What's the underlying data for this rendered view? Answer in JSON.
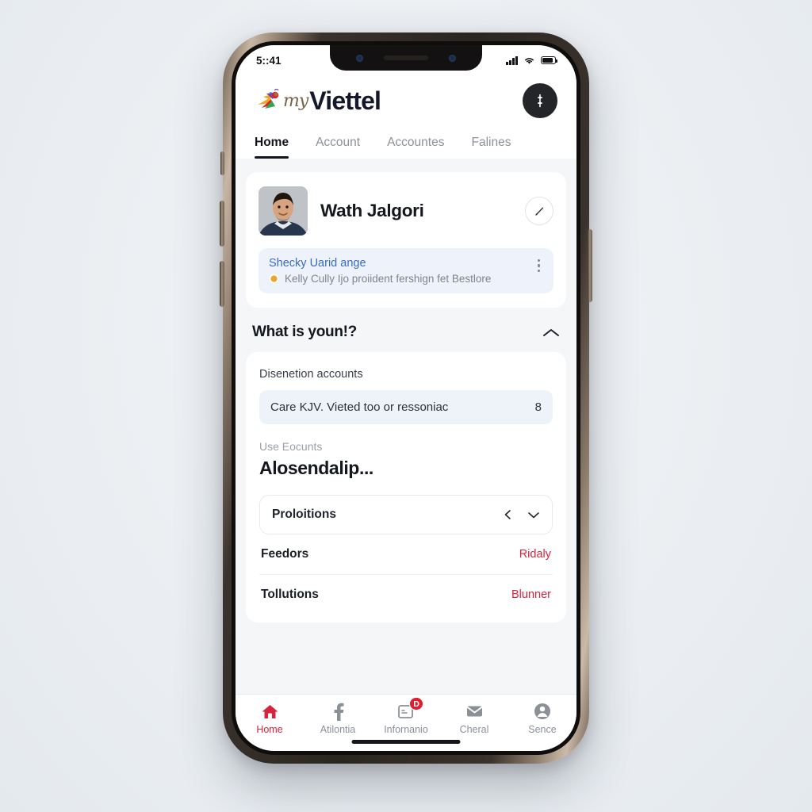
{
  "status_bar": {
    "time": "5::41",
    "signal_icon": "signal-bars-icon",
    "wifi_icon": "wifi-icon",
    "battery_icon": "battery-icon"
  },
  "header": {
    "brand_prefix": "my",
    "brand_name": "Viettel",
    "logo_icon": "viettel-butterfly-logo-icon",
    "assist_icon": "assistant-glyph-icon"
  },
  "tabs": [
    {
      "label": "Home",
      "active": true
    },
    {
      "label": "Account",
      "active": false
    },
    {
      "label": "Accountes",
      "active": false
    },
    {
      "label": "Falines",
      "active": false
    }
  ],
  "profile": {
    "name": "Wath Jalgori",
    "avatar_icon": "user-photo-avatar",
    "edit_icon": "pencil-edit-icon"
  },
  "notice": {
    "title": "Shecky Uarid ange",
    "subtitle": "Kelly Cully Ijo proiident fershign fet Bestlore",
    "dot_icon": "warning-dot-icon",
    "menu_icon": "more-vertical-icon"
  },
  "section": {
    "title": "What is youn!?",
    "collapse_icon": "chevron-up-icon"
  },
  "accounts_card": {
    "sub_label": "Disenetion accounts",
    "pill_text": "Care KJV. Vieted too or ressoniac",
    "pill_count": "8",
    "use_label": "Use Eocunts",
    "big_value": "Alosendalip...",
    "select_label": "Proloitions",
    "select_icon_left": "chevron-left-icon",
    "select_icon_right": "chevron-down-icon",
    "rows": [
      {
        "label": "Feedors",
        "value": "Ridaly"
      },
      {
        "label": "Tollutions",
        "value": "Blunner"
      }
    ]
  },
  "bottom_nav": [
    {
      "label": "Home",
      "icon": "home-icon",
      "active": true,
      "badge": ""
    },
    {
      "label": "Atilontia",
      "icon": "facebook-f-icon",
      "active": false,
      "badge": ""
    },
    {
      "label": "Infornanio",
      "icon": "document-card-icon",
      "active": false,
      "badge": "D"
    },
    {
      "label": "Cheral",
      "icon": "envelope-mail-icon",
      "active": false,
      "badge": ""
    },
    {
      "label": "Sence",
      "icon": "user-circle-icon",
      "active": false,
      "badge": ""
    }
  ],
  "colors": {
    "brand_red": "#d8233c",
    "accent_blue": "#3b6bc4",
    "screen_bg": "#f4f6f8",
    "card_bg": "#ffffff",
    "notice_bg": "#edf2fb"
  }
}
